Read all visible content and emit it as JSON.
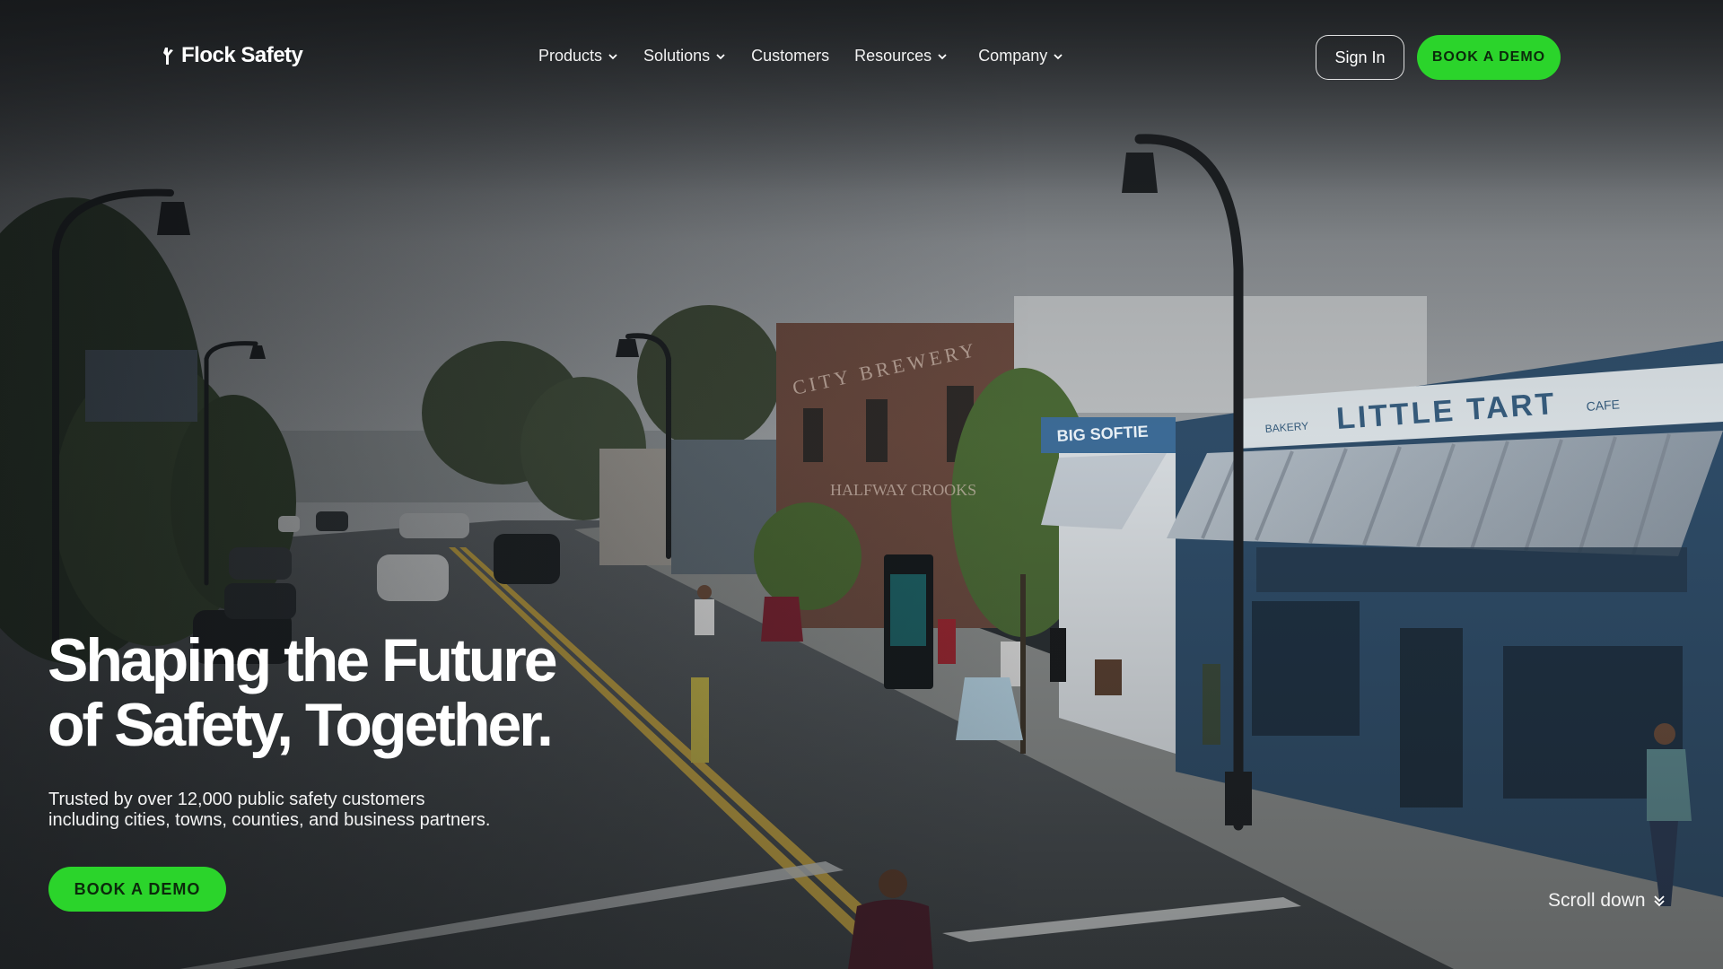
{
  "brand": {
    "name": "Flock Safety",
    "icon": "flock-logo-icon"
  },
  "nav": {
    "items": [
      {
        "label": "Products",
        "has_dropdown": true
      },
      {
        "label": "Solutions",
        "has_dropdown": true
      },
      {
        "label": "Customers",
        "has_dropdown": false
      },
      {
        "label": "Resources",
        "has_dropdown": true
      },
      {
        "label": "Company",
        "has_dropdown": true
      }
    ],
    "sign_in_label": "Sign In",
    "book_demo_label": "BOOK A DEMO"
  },
  "hero": {
    "headline_line1": "Shaping the Future",
    "headline_line2": "of Safety, Together.",
    "subline_line1": "Trusted by over 12,000 public safety customers",
    "subline_line2": "including cities, towns, counties, and business partners.",
    "cta_label": "BOOK A DEMO",
    "scroll_label": "Scroll down",
    "storefront_signs": [
      "LITTLE TART",
      "BAKERY",
      "CAFE",
      "BIG SOFTIE",
      "CITY BREWERY",
      "HALFWAY CROOKS"
    ]
  },
  "colors": {
    "accent": "#2bd42b",
    "accent_text": "#0b2a0b",
    "text": "#ffffff"
  }
}
